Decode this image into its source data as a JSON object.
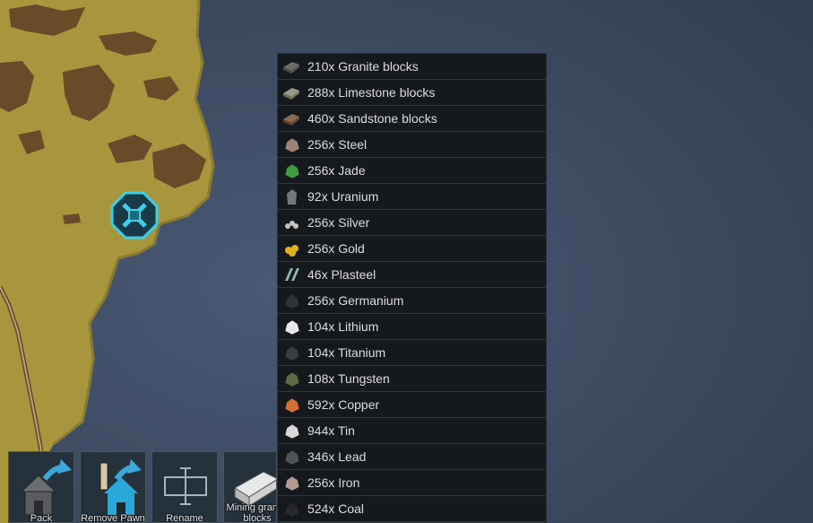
{
  "context_menu": {
    "items": [
      {
        "label": "210x Granite blocks",
        "icon": "granite-blocks-icon",
        "color": "#6e6a68"
      },
      {
        "label": "288x Limestone blocks",
        "icon": "limestone-blocks-icon",
        "color": "#9c9a86"
      },
      {
        "label": "460x Sandstone blocks",
        "icon": "sandstone-blocks-icon",
        "color": "#8e6a52"
      },
      {
        "label": "256x Steel",
        "icon": "steel-icon",
        "color": "#9a8478"
      },
      {
        "label": "256x Jade",
        "icon": "jade-icon",
        "color": "#3e9a44"
      },
      {
        "label": "92x Uranium",
        "icon": "uranium-icon",
        "color": "#74767a"
      },
      {
        "label": "256x Silver",
        "icon": "silver-icon",
        "color": "#c4c4c0"
      },
      {
        "label": "256x Gold",
        "icon": "gold-icon",
        "color": "#e2b41c"
      },
      {
        "label": "46x Plasteel",
        "icon": "plasteel-icon",
        "color": "#8cb8b0"
      },
      {
        "label": "256x Germanium",
        "icon": "germanium-icon",
        "color": "#303234"
      },
      {
        "label": "104x Lithium",
        "icon": "lithium-icon",
        "color": "#e8e8e8"
      },
      {
        "label": "104x Titanium",
        "icon": "titanium-icon",
        "color": "#3a3c40"
      },
      {
        "label": "108x Tungsten",
        "icon": "tungsten-icon",
        "color": "#5a6a44"
      },
      {
        "label": "592x Copper",
        "icon": "copper-icon",
        "color": "#d2703a"
      },
      {
        "label": "944x Tin",
        "icon": "tin-icon",
        "color": "#d8d8d8"
      },
      {
        "label": "346x Lead",
        "icon": "lead-icon",
        "color": "#505256"
      },
      {
        "label": "256x Iron",
        "icon": "iron-icon",
        "color": "#b09a94"
      },
      {
        "label": "524x Coal",
        "icon": "coal-icon",
        "color": "#26282a"
      }
    ]
  },
  "commands": {
    "pack": "Pack",
    "remove_pawn": "Remove Pawn",
    "rename": "Rename",
    "mining": "Mining granite blocks"
  }
}
